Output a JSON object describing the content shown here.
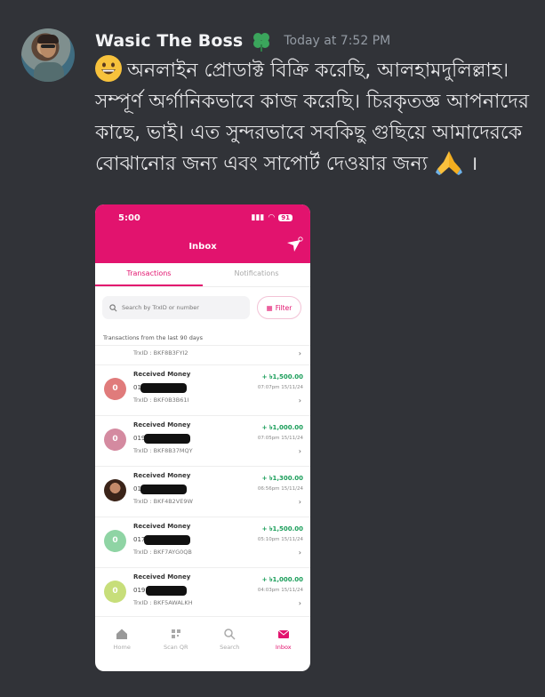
{
  "message": {
    "username": "Wasic The Boss",
    "timestamp": "Today at 7:52 PM",
    "text": "অনলাইন প্রোডাক্ট বিক্রি করেছি, আলহামদুলিল্লাহ। সম্পূর্ণ অর্গানিকভাবে কাজ করেছি। চিরকৃতজ্ঞ আপনাদের কাছে, ভাই। এত সুন্দরভাবে সবকিছু গুছিয়ে আমাদেরকে বোঝানোর জন্য এবং সাপোর্ট দেওয়ার জন্য",
    "end_punct": " ।",
    "lead_emoji": "grinning-face-emoji",
    "trail_emoji": "folded-hands-emoji",
    "badge_icon": "clover-badge-icon"
  },
  "phone": {
    "status_time": "5:00",
    "battery": "91",
    "screen_title": "Inbox",
    "tabs": [
      "Transactions",
      "Notifications"
    ],
    "active_tab": "Transactions",
    "search_placeholder": "Search by TrxID or number",
    "filter_label": "Filter",
    "list_caption": "Transactions from the last 90 days",
    "partial_trxid": "TrxID : BKF8B3FYI2",
    "transactions": [
      {
        "title": "Received Money",
        "number": "01",
        "trxid": "TrxID : BKF0B3B61I",
        "amount": "+ ৳1,500.00",
        "time": "07:07pm 15/11/24",
        "avatar_letter": "0",
        "avatar_color": "#e07b7b"
      },
      {
        "title": "Received Money",
        "number": "019",
        "trxid": "TrxID : BKF8B37MQY",
        "amount": "+ ৳1,000.00",
        "time": "07:05pm 15/11/24",
        "avatar_letter": "0",
        "avatar_color": "#d48aa0"
      },
      {
        "title": "Received Money",
        "number": "01",
        "trxid": "TrxID : BKF4B2VE9W",
        "amount": "+ ৳1,300.00",
        "time": "06:56pm 15/11/24",
        "avatar_letter": "",
        "avatar_color": "#5a3b2e"
      },
      {
        "title": "Received Money",
        "number": "017",
        "trxid": "TrxID : BKF7AYG0QB",
        "amount": "+ ৳1,500.00",
        "time": "05:10pm 15/11/24",
        "avatar_letter": "0",
        "avatar_color": "#8fd4a4"
      },
      {
        "title": "Received Money",
        "number": "019",
        "trxid": "TrxID : BKF5AWALKH",
        "amount": "+ ৳1,000.00",
        "time": "04:03pm 15/11/24",
        "avatar_letter": "0",
        "avatar_color": "#c7de7a"
      }
    ],
    "nav": [
      {
        "label": "Home",
        "icon": "home-icon"
      },
      {
        "label": "Scan QR",
        "icon": "scan-qr-icon"
      },
      {
        "label": "Search",
        "icon": "search-icon"
      },
      {
        "label": "Inbox",
        "icon": "inbox-icon"
      }
    ],
    "accent": "#e2136e"
  }
}
